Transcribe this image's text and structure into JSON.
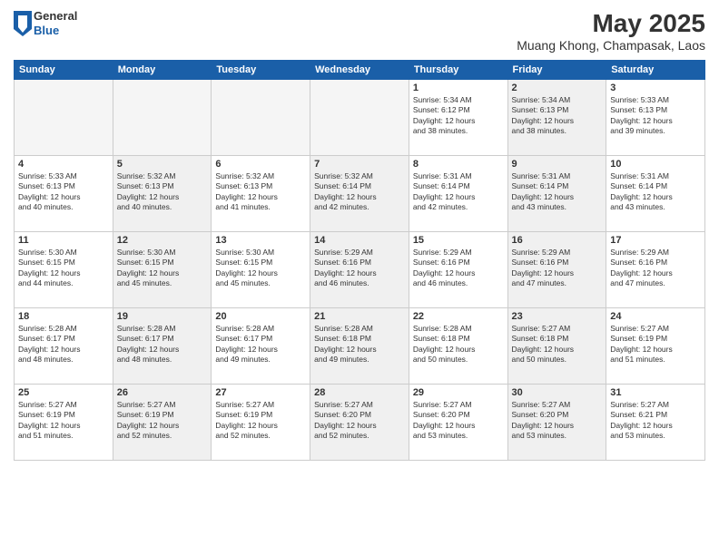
{
  "header": {
    "logo": {
      "general": "General",
      "blue": "Blue"
    },
    "title": "May 2025",
    "location": "Muang Khong, Champasak, Laos"
  },
  "weekdays": [
    "Sunday",
    "Monday",
    "Tuesday",
    "Wednesday",
    "Thursday",
    "Friday",
    "Saturday"
  ],
  "weeks": [
    [
      {
        "day": "",
        "info": "",
        "empty": true
      },
      {
        "day": "",
        "info": "",
        "empty": true
      },
      {
        "day": "",
        "info": "",
        "empty": true
      },
      {
        "day": "",
        "info": "",
        "empty": true
      },
      {
        "day": "1",
        "info": "Sunrise: 5:34 AM\nSunset: 6:12 PM\nDaylight: 12 hours\nand 38 minutes.",
        "empty": false,
        "shaded": false
      },
      {
        "day": "2",
        "info": "Sunrise: 5:34 AM\nSunset: 6:13 PM\nDaylight: 12 hours\nand 38 minutes.",
        "empty": false,
        "shaded": true
      },
      {
        "day": "3",
        "info": "Sunrise: 5:33 AM\nSunset: 6:13 PM\nDaylight: 12 hours\nand 39 minutes.",
        "empty": false,
        "shaded": false
      }
    ],
    [
      {
        "day": "4",
        "info": "Sunrise: 5:33 AM\nSunset: 6:13 PM\nDaylight: 12 hours\nand 40 minutes.",
        "empty": false,
        "shaded": false
      },
      {
        "day": "5",
        "info": "Sunrise: 5:32 AM\nSunset: 6:13 PM\nDaylight: 12 hours\nand 40 minutes.",
        "empty": false,
        "shaded": true
      },
      {
        "day": "6",
        "info": "Sunrise: 5:32 AM\nSunset: 6:13 PM\nDaylight: 12 hours\nand 41 minutes.",
        "empty": false,
        "shaded": false
      },
      {
        "day": "7",
        "info": "Sunrise: 5:32 AM\nSunset: 6:14 PM\nDaylight: 12 hours\nand 42 minutes.",
        "empty": false,
        "shaded": true
      },
      {
        "day": "8",
        "info": "Sunrise: 5:31 AM\nSunset: 6:14 PM\nDaylight: 12 hours\nand 42 minutes.",
        "empty": false,
        "shaded": false
      },
      {
        "day": "9",
        "info": "Sunrise: 5:31 AM\nSunset: 6:14 PM\nDaylight: 12 hours\nand 43 minutes.",
        "empty": false,
        "shaded": true
      },
      {
        "day": "10",
        "info": "Sunrise: 5:31 AM\nSunset: 6:14 PM\nDaylight: 12 hours\nand 43 minutes.",
        "empty": false,
        "shaded": false
      }
    ],
    [
      {
        "day": "11",
        "info": "Sunrise: 5:30 AM\nSunset: 6:15 PM\nDaylight: 12 hours\nand 44 minutes.",
        "empty": false,
        "shaded": false
      },
      {
        "day": "12",
        "info": "Sunrise: 5:30 AM\nSunset: 6:15 PM\nDaylight: 12 hours\nand 45 minutes.",
        "empty": false,
        "shaded": true
      },
      {
        "day": "13",
        "info": "Sunrise: 5:30 AM\nSunset: 6:15 PM\nDaylight: 12 hours\nand 45 minutes.",
        "empty": false,
        "shaded": false
      },
      {
        "day": "14",
        "info": "Sunrise: 5:29 AM\nSunset: 6:16 PM\nDaylight: 12 hours\nand 46 minutes.",
        "empty": false,
        "shaded": true
      },
      {
        "day": "15",
        "info": "Sunrise: 5:29 AM\nSunset: 6:16 PM\nDaylight: 12 hours\nand 46 minutes.",
        "empty": false,
        "shaded": false
      },
      {
        "day": "16",
        "info": "Sunrise: 5:29 AM\nSunset: 6:16 PM\nDaylight: 12 hours\nand 47 minutes.",
        "empty": false,
        "shaded": true
      },
      {
        "day": "17",
        "info": "Sunrise: 5:29 AM\nSunset: 6:16 PM\nDaylight: 12 hours\nand 47 minutes.",
        "empty": false,
        "shaded": false
      }
    ],
    [
      {
        "day": "18",
        "info": "Sunrise: 5:28 AM\nSunset: 6:17 PM\nDaylight: 12 hours\nand 48 minutes.",
        "empty": false,
        "shaded": false
      },
      {
        "day": "19",
        "info": "Sunrise: 5:28 AM\nSunset: 6:17 PM\nDaylight: 12 hours\nand 48 minutes.",
        "empty": false,
        "shaded": true
      },
      {
        "day": "20",
        "info": "Sunrise: 5:28 AM\nSunset: 6:17 PM\nDaylight: 12 hours\nand 49 minutes.",
        "empty": false,
        "shaded": false
      },
      {
        "day": "21",
        "info": "Sunrise: 5:28 AM\nSunset: 6:18 PM\nDaylight: 12 hours\nand 49 minutes.",
        "empty": false,
        "shaded": true
      },
      {
        "day": "22",
        "info": "Sunrise: 5:28 AM\nSunset: 6:18 PM\nDaylight: 12 hours\nand 50 minutes.",
        "empty": false,
        "shaded": false
      },
      {
        "day": "23",
        "info": "Sunrise: 5:27 AM\nSunset: 6:18 PM\nDaylight: 12 hours\nand 50 minutes.",
        "empty": false,
        "shaded": true
      },
      {
        "day": "24",
        "info": "Sunrise: 5:27 AM\nSunset: 6:19 PM\nDaylight: 12 hours\nand 51 minutes.",
        "empty": false,
        "shaded": false
      }
    ],
    [
      {
        "day": "25",
        "info": "Sunrise: 5:27 AM\nSunset: 6:19 PM\nDaylight: 12 hours\nand 51 minutes.",
        "empty": false,
        "shaded": false
      },
      {
        "day": "26",
        "info": "Sunrise: 5:27 AM\nSunset: 6:19 PM\nDaylight: 12 hours\nand 52 minutes.",
        "empty": false,
        "shaded": true
      },
      {
        "day": "27",
        "info": "Sunrise: 5:27 AM\nSunset: 6:19 PM\nDaylight: 12 hours\nand 52 minutes.",
        "empty": false,
        "shaded": false
      },
      {
        "day": "28",
        "info": "Sunrise: 5:27 AM\nSunset: 6:20 PM\nDaylight: 12 hours\nand 52 minutes.",
        "empty": false,
        "shaded": true
      },
      {
        "day": "29",
        "info": "Sunrise: 5:27 AM\nSunset: 6:20 PM\nDaylight: 12 hours\nand 53 minutes.",
        "empty": false,
        "shaded": false
      },
      {
        "day": "30",
        "info": "Sunrise: 5:27 AM\nSunset: 6:20 PM\nDaylight: 12 hours\nand 53 minutes.",
        "empty": false,
        "shaded": true
      },
      {
        "day": "31",
        "info": "Sunrise: 5:27 AM\nSunset: 6:21 PM\nDaylight: 12 hours\nand 53 minutes.",
        "empty": false,
        "shaded": false
      }
    ]
  ]
}
